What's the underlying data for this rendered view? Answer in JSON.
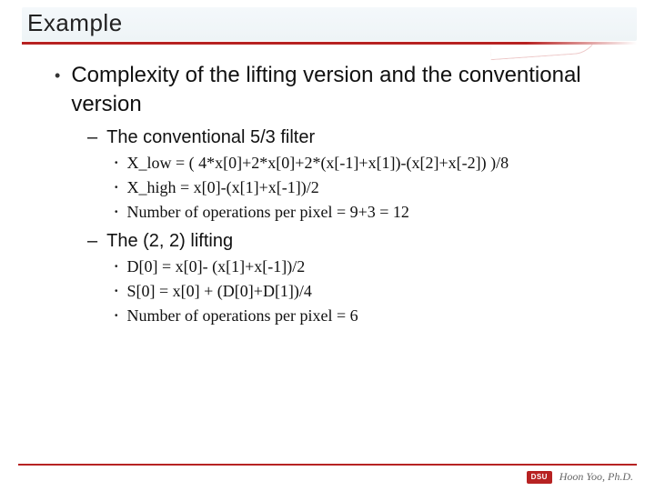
{
  "title": "Example",
  "main_bullet": "Complexity of the lifting version and the conventional version",
  "sections": [
    {
      "heading": "The conventional 5/3 filter",
      "items": [
        "X_low = ( 4*x[0]+2*x[0]+2*(x[-1]+x[1])-(x[2]+x[-2]) )/8",
        "X_high = x[0]-(x[1]+x[-1])/2",
        "Number of operations per pixel = 9+3 = 12"
      ]
    },
    {
      "heading": "The (2, 2) lifting",
      "items": [
        "D[0] = x[0]- (x[1]+x[-1])/2",
        "S[0] = x[0] + (D[0]+D[1])/4",
        "Number of operations per pixel = 6"
      ]
    }
  ],
  "footer": {
    "logo_text": "DSU",
    "author": "Hoon Yoo, Ph.D."
  }
}
